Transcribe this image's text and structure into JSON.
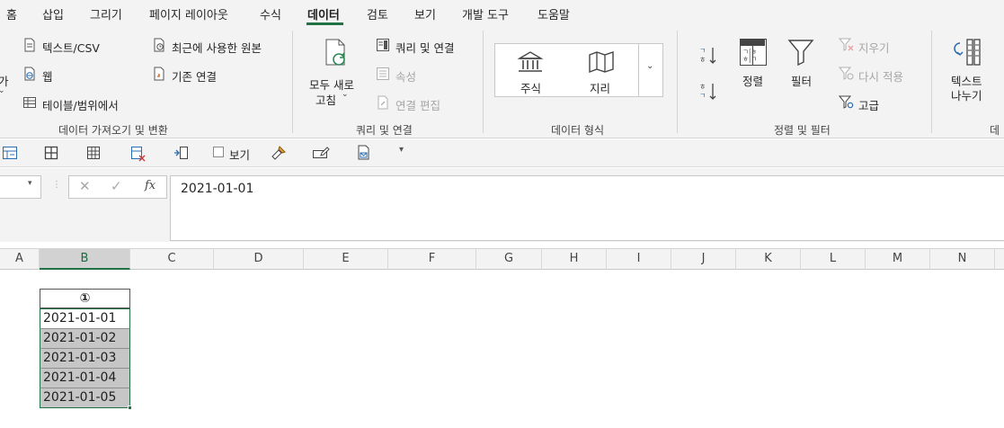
{
  "ribbon_tabs": [
    "홈",
    "삽입",
    "그리기",
    "페이지 레이아웃",
    "수식",
    "데이터",
    "검토",
    "보기",
    "개발 도구",
    "도움말"
  ],
  "active_tab": "데이터",
  "get_data": {
    "partial_label": "가",
    "text_csv": "텍스트/CSV",
    "web": "웹",
    "from_table": "테이블/범위에서",
    "recent_sources": "최근에 사용한 원본",
    "existing_connections": "기존 연결",
    "group_label": "데이터 가져오기 및 변환"
  },
  "queries": {
    "refresh_all_line1": "모두 새로",
    "refresh_all_line2": "고침",
    "queries_connections": "쿼리 및 연결",
    "properties": "속성",
    "edit_links": "연결 편집",
    "group_label": "쿼리 및 연결"
  },
  "data_types": {
    "stocks": "주식",
    "geography": "지리",
    "group_label": "데이터 형식"
  },
  "sort_filter": {
    "sort": "정렬",
    "filter": "필터",
    "clear": "지우기",
    "reapply": "다시 적용",
    "advanced": "고급",
    "group_label": "정렬 및 필터",
    "sort_icon_top_line1": "ㄱ|ㅎ",
    "sort_icon_top_line2": "ㅎ|ㄱ"
  },
  "data_tools": {
    "text_to_columns_line1": "텍스트",
    "text_to_columns_line2": "나누기",
    "group_label_partial": "데"
  },
  "qat": {
    "view_checkbox_label": "보기",
    "view_checked": false
  },
  "formula_bar": {
    "name_box": "",
    "formula": "2021-01-01"
  },
  "columns": [
    "A",
    "B",
    "C",
    "D",
    "E",
    "F",
    "G",
    "H",
    "I",
    "J",
    "K",
    "L",
    "M",
    "N"
  ],
  "selected_column": "B",
  "cells": {
    "header_marker": "①",
    "values": [
      "2021-01-01",
      "2021-01-02",
      "2021-01-03",
      "2021-01-04",
      "2021-01-05"
    ]
  },
  "colors": {
    "accent": "#217346",
    "selection_fill": "#c6c6c6",
    "ribbon_bg": "#f3f3f3"
  }
}
